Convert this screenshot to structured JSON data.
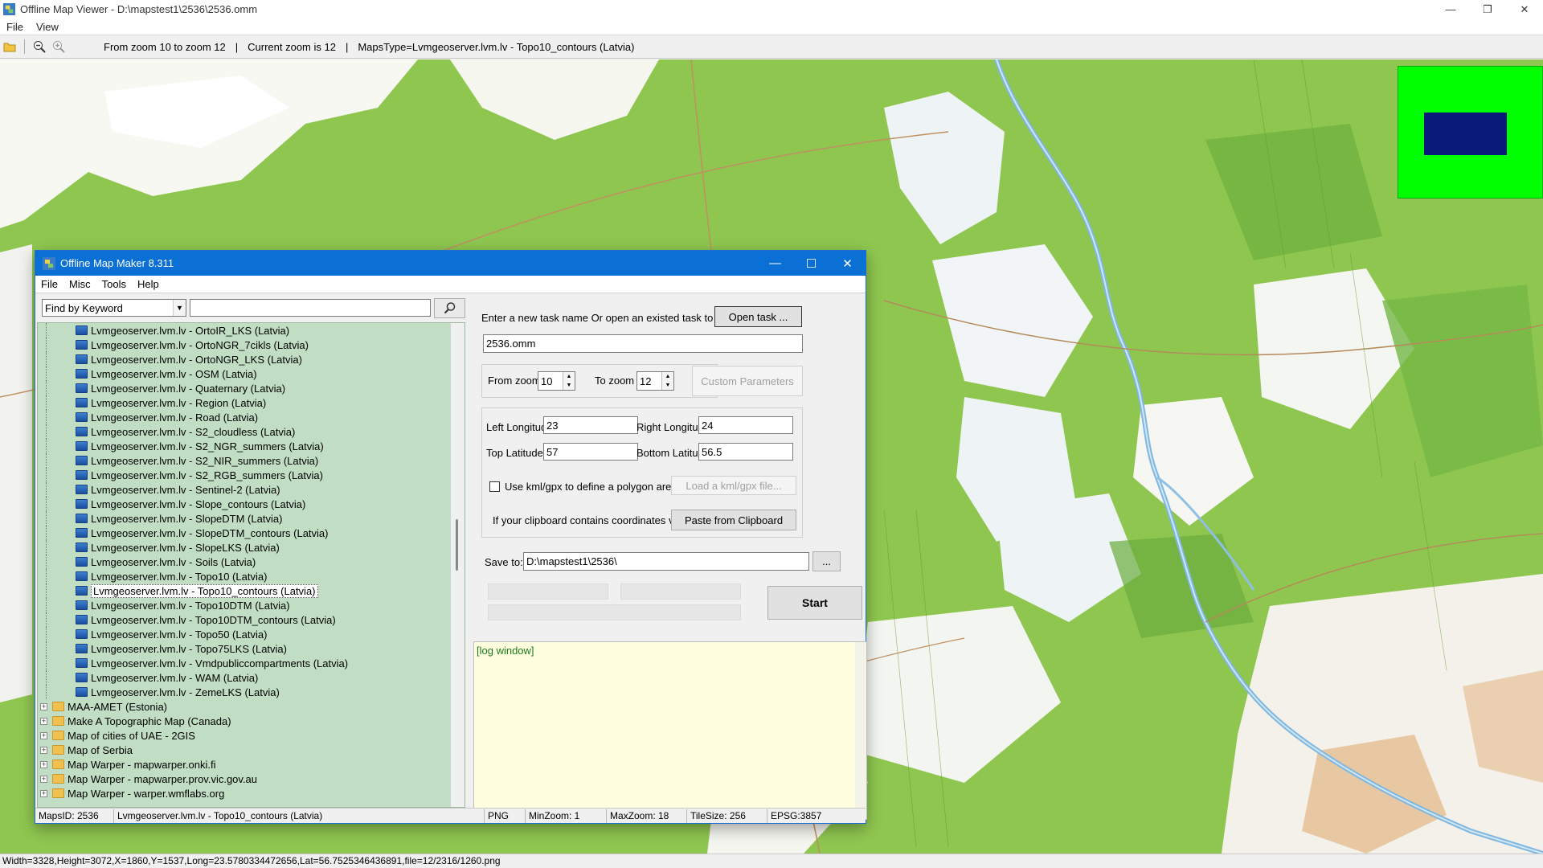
{
  "window": {
    "title": "Offline Map Viewer - D:\\mapstest1\\2536\\2536.omm",
    "controls": [
      "—",
      "❐",
      "✕"
    ]
  },
  "menu": [
    "File",
    "View"
  ],
  "toolbar": {
    "zoom_range": "From zoom 10 to zoom 12",
    "separator": "|",
    "current_zoom": "Current zoom is 12",
    "maps_type": "MapsType=Lvmgeoserver.lvm.lv - Topo10_contours (Latvia)"
  },
  "status_bar": "Width=3328,Height=3072,X=1860,Y=1537,Long=23.5780334472656,Lat=56.7525346436891,file=12/2316/1260.png",
  "colors": {
    "map_green": "#8fc650",
    "overview_bg": "#00ff00",
    "overview_rect": "#0a1a7a",
    "dialog_title": "#0a70d6",
    "tree_bg": "#c1ddc3",
    "log_bg": "#ffffe0"
  },
  "dialog": {
    "title": "Offline Map Maker 8.311",
    "controls": [
      "—",
      "☐",
      "✕"
    ],
    "menu": [
      "File",
      "Misc",
      "Tools",
      "Help"
    ],
    "search": {
      "mode": "Find by Keyword",
      "value": ""
    },
    "tree": {
      "children": [
        "Lvmgeoserver.lvm.lv - OrtoIR_LKS (Latvia)",
        "Lvmgeoserver.lvm.lv - OrtoNGR_7cikls (Latvia)",
        "Lvmgeoserver.lvm.lv - OrtoNGR_LKS (Latvia)",
        "Lvmgeoserver.lvm.lv - OSM (Latvia)",
        "Lvmgeoserver.lvm.lv - Quaternary (Latvia)",
        "Lvmgeoserver.lvm.lv - Region (Latvia)",
        "Lvmgeoserver.lvm.lv - Road (Latvia)",
        "Lvmgeoserver.lvm.lv - S2_cloudless (Latvia)",
        "Lvmgeoserver.lvm.lv - S2_NGR_summers (Latvia)",
        "Lvmgeoserver.lvm.lv - S2_NIR_summers (Latvia)",
        "Lvmgeoserver.lvm.lv - S2_RGB_summers (Latvia)",
        "Lvmgeoserver.lvm.lv - Sentinel-2 (Latvia)",
        "Lvmgeoserver.lvm.lv - Slope_contours (Latvia)",
        "Lvmgeoserver.lvm.lv - SlopeDTM (Latvia)",
        "Lvmgeoserver.lvm.lv - SlopeDTM_contours (Latvia)",
        "Lvmgeoserver.lvm.lv - SlopeLKS (Latvia)",
        "Lvmgeoserver.lvm.lv - Soils (Latvia)",
        "Lvmgeoserver.lvm.lv - Topo10 (Latvia)",
        "Lvmgeoserver.lvm.lv - Topo10_contours (Latvia)",
        "Lvmgeoserver.lvm.lv - Topo10DTM (Latvia)",
        "Lvmgeoserver.lvm.lv - Topo10DTM_contours (Latvia)",
        "Lvmgeoserver.lvm.lv - Topo50 (Latvia)",
        "Lvmgeoserver.lvm.lv - Topo75LKS (Latvia)",
        "Lvmgeoserver.lvm.lv - Vmdpubliccompartments (Latvia)",
        "Lvmgeoserver.lvm.lv - WAM (Latvia)",
        "Lvmgeoserver.lvm.lv - ZemeLKS (Latvia)"
      ],
      "selected": "Lvmgeoserver.lvm.lv - Topo10_contours (Latvia)",
      "folders": [
        "MAA-AMET (Estonia)",
        "Make A Topographic Map (Canada)",
        "Map of cities of UAE - 2GIS",
        "Map of Serbia",
        "Map Warper - mapwarper.onki.fi",
        "Map Warper - mapwarper.prov.vic.gov.au",
        "Map Warper - warper.wmflabs.org"
      ]
    },
    "task": {
      "prompt": "Enter a new task name Or open an existed task to continue:",
      "open_button": "Open task ...",
      "name": "2536.omm"
    },
    "zoom": {
      "from_label": "From zoom",
      "from_value": "10",
      "to_label": "To zoom",
      "to_value": "12",
      "custom_button": "Custom Parameters"
    },
    "coords": {
      "left_label": "Left Longitude",
      "left_value": "23",
      "right_label": "Right Longitude",
      "right_value": "24",
      "top_label": "Top Latitude",
      "top_value": "57",
      "bottom_label": "Bottom Latitude",
      "bottom_value": "56.5",
      "kml_label": "Use kml/gpx to define a polygon area",
      "kml_button": "Load a kml/gpx file...",
      "clipboard_label": "If your clipboard contains coordinates values:",
      "clipboard_button": "Paste from Clipboard"
    },
    "save": {
      "label": "Save to:",
      "path": "D:\\mapstest1\\2536\\",
      "browse": "..."
    },
    "start_button": "Start",
    "log": "[log window]",
    "status": {
      "maps_id": "MapsID: 2536",
      "map_name": "Lvmgeoserver.lvm.lv - Topo10_contours (Latvia)",
      "format": "PNG",
      "min_zoom": "MinZoom: 1",
      "max_zoom": "MaxZoom: 18",
      "tile_size": "TileSize: 256",
      "epsg": "EPSG:3857"
    }
  }
}
